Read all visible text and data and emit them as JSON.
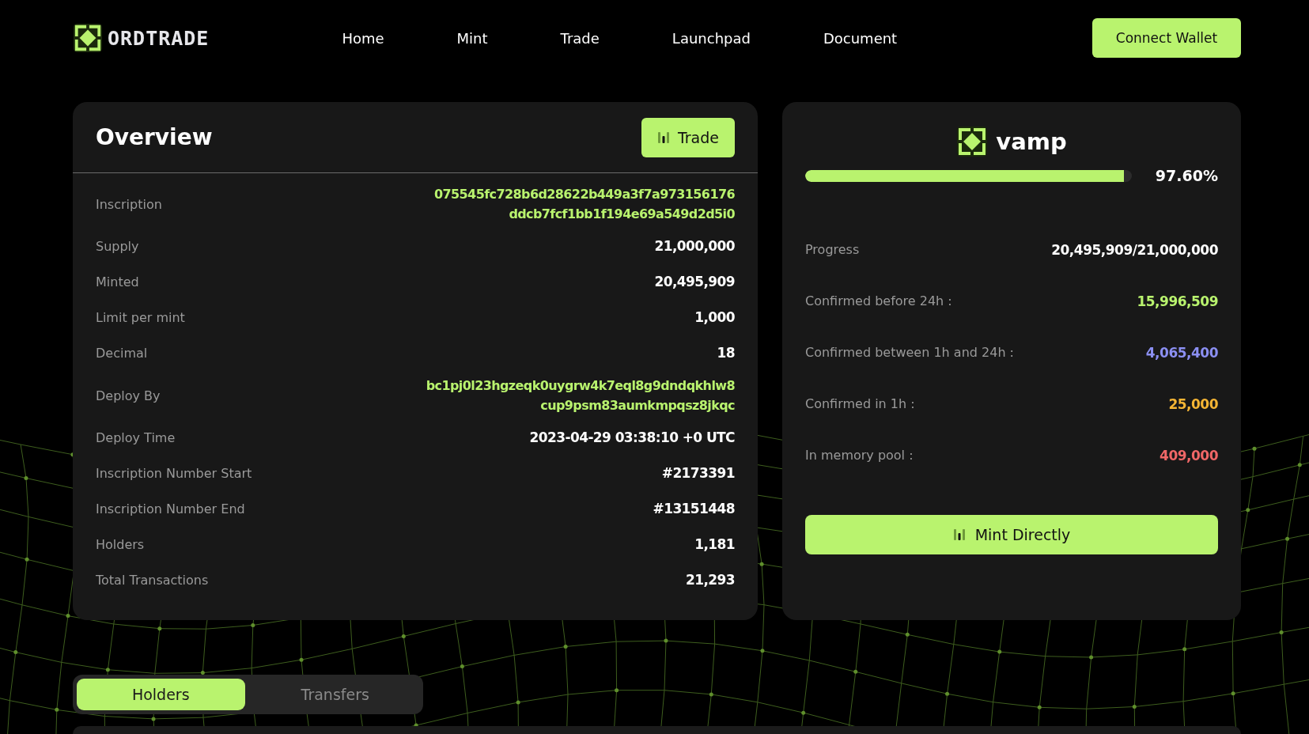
{
  "header": {
    "logo": "ORDTRADE",
    "nav": [
      {
        "label": "Home"
      },
      {
        "label": "Mint"
      },
      {
        "label": "Trade"
      },
      {
        "label": "Launchpad"
      },
      {
        "label": "Document"
      }
    ],
    "connect_button": "Connect Wallet"
  },
  "overview": {
    "title": "Overview",
    "trade_button": "Trade",
    "rows": [
      {
        "label": "Inscription",
        "kind": "hash",
        "lines": [
          "075545fc728b6d28622b449a3f7a973156176",
          "ddcb7fcf1bb1f194e69a549d2d5i0"
        ]
      },
      {
        "label": "Supply",
        "kind": "text",
        "lines": [
          "21,000,000"
        ]
      },
      {
        "label": "Minted",
        "kind": "text",
        "lines": [
          "20,495,909"
        ]
      },
      {
        "label": "Limit per mint",
        "kind": "text",
        "lines": [
          "1,000"
        ]
      },
      {
        "label": "Decimal",
        "kind": "text",
        "lines": [
          "18"
        ]
      },
      {
        "label": "Deploy By",
        "kind": "hash",
        "lines": [
          "bc1pj0l23hgzeqk0uygrw4k7eql8g9dndqkhlw8",
          "cup9psm83aumkmpqsz8jkqc"
        ]
      },
      {
        "label": "Deploy Time",
        "kind": "text",
        "lines": [
          "2023-04-29 03:38:10 +0 UTC"
        ]
      },
      {
        "label": "Inscription Number Start",
        "kind": "text",
        "lines": [
          "#2173391"
        ]
      },
      {
        "label": "Inscription Number End",
        "kind": "text",
        "lines": [
          "#13151448"
        ]
      },
      {
        "label": "Holders",
        "kind": "text",
        "lines": [
          "1,181"
        ]
      },
      {
        "label": "Total Transactions",
        "kind": "text",
        "lines": [
          "21,293"
        ]
      }
    ]
  },
  "token": {
    "name": "vamp",
    "progress": {
      "level": 0.976,
      "reading": "97.60%"
    },
    "stats": [
      {
        "label": "Progress",
        "value": "20,495,909/21,000,000",
        "color": "#ffffff"
      },
      {
        "label": "Confirmed before 24h :",
        "value": "15,996,509",
        "color": "#b9f36e"
      },
      {
        "label": "Confirmed between 1h and 24h :",
        "value": "4,065,400",
        "color": "#8b8ff2"
      },
      {
        "label": "Confirmed in 1h :",
        "value": "25,000",
        "color": "#f5b534"
      },
      {
        "label": "In memory pool :",
        "value": "409,000",
        "color": "#f06767"
      }
    ],
    "mint_button": "Mint Directly"
  },
  "tabs": [
    {
      "label": "Holders",
      "selected": true
    },
    {
      "label": "Transfers",
      "selected": false
    }
  ]
}
